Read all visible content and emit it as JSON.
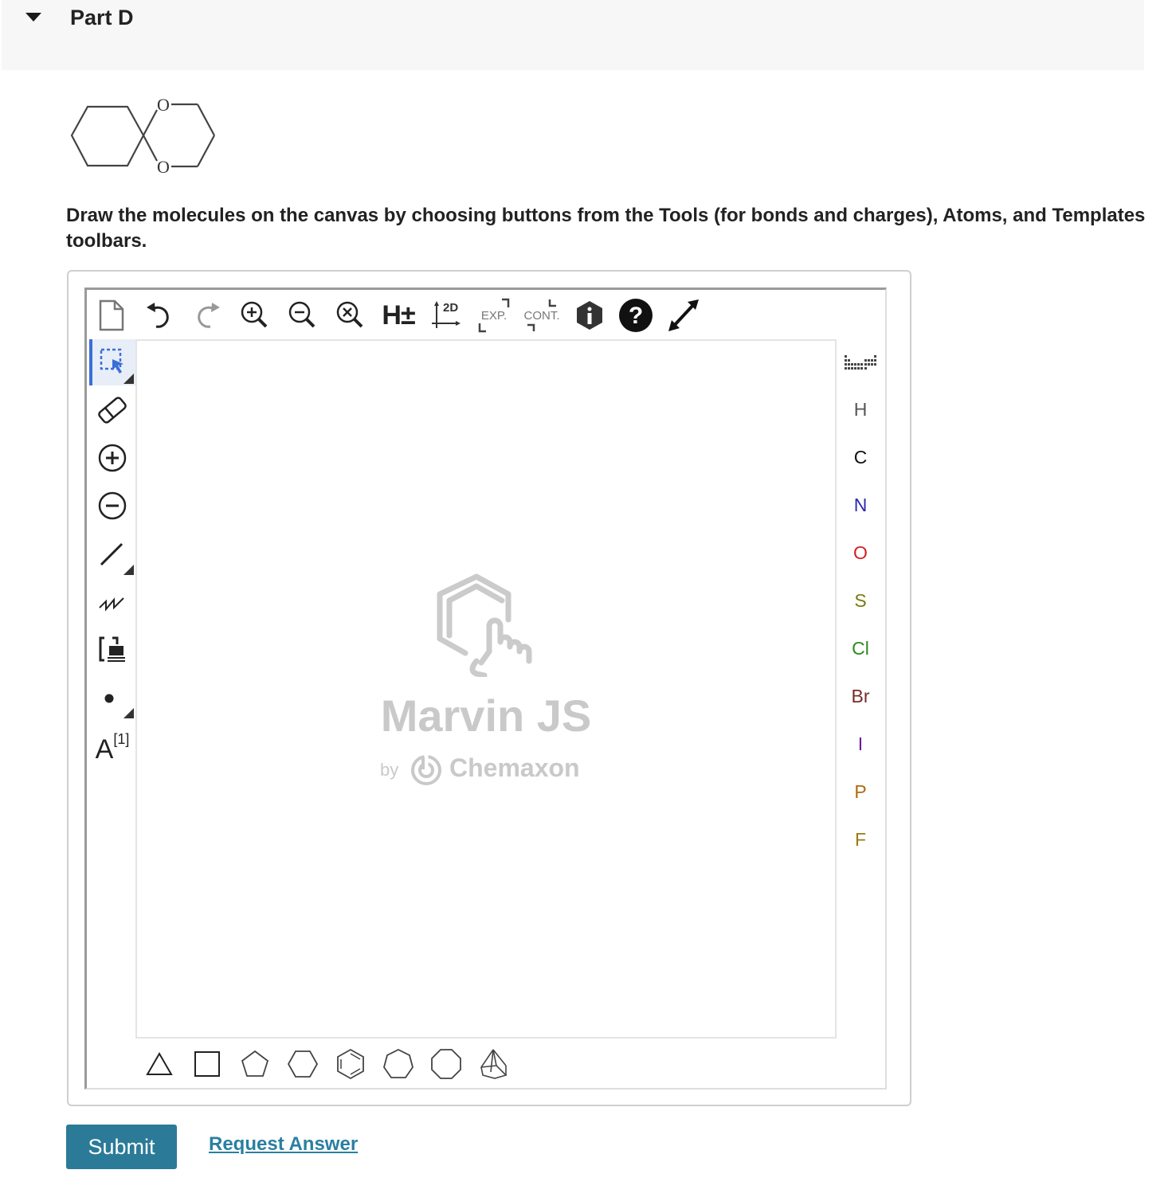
{
  "part": {
    "title": "Part D"
  },
  "question": {
    "molecule_atoms": [
      "O",
      "O"
    ],
    "instructions": "Draw the molecules on the canvas by choosing buttons from the Tools (for bonds and charges), Atoms, and Templates toolbars."
  },
  "editor": {
    "top_toolbar": {
      "hydrogen_label": "H±",
      "clean2d_label": "2D",
      "expand_label": "EXP.",
      "contract_label": "CONT."
    },
    "left_toolbar": {
      "atom_map_label": "A",
      "atom_map_index": "[1]"
    },
    "brand": {
      "title": "Marvin JS",
      "by": "by",
      "company": "Chemaxon"
    },
    "atoms": [
      {
        "symbol": "H",
        "color": "#555555"
      },
      {
        "symbol": "C",
        "color": "#111111"
      },
      {
        "symbol": "N",
        "color": "#2a2ab0"
      },
      {
        "symbol": "O",
        "color": "#d42020"
      },
      {
        "symbol": "S",
        "color": "#7a7a10"
      },
      {
        "symbol": "Cl",
        "color": "#2e8b20"
      },
      {
        "symbol": "Br",
        "color": "#7a2a2a"
      },
      {
        "symbol": "I",
        "color": "#6a1aa0"
      },
      {
        "symbol": "P",
        "color": "#b06a10"
      },
      {
        "symbol": "F",
        "color": "#9a7a10"
      }
    ]
  },
  "actions": {
    "submit_label": "Submit",
    "request_label": "Request Answer"
  },
  "colors": {
    "submit_bg": "#2b7a98",
    "link": "#2a7fa1",
    "selected_tool": "#3a6fd8"
  }
}
